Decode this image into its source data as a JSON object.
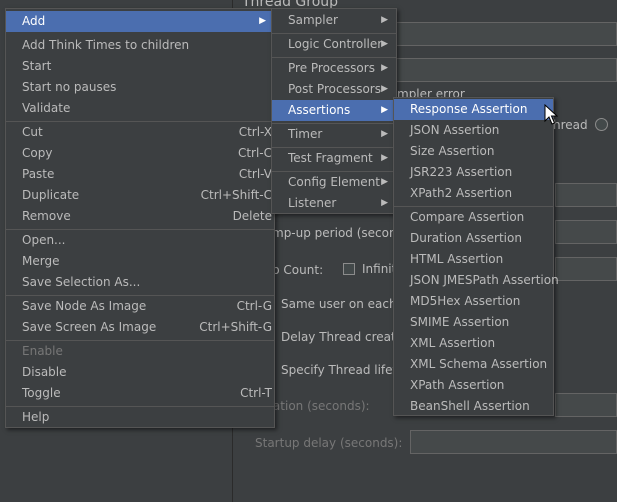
{
  "background": {
    "title_fragment": "Thread Group",
    "sampler_error_fragment": "mpler error",
    "thread_fragment": "hread",
    "ramp_up_fragment": "mp-up period (seconds",
    "loop_count_fragment": "p Count:",
    "infinite_fragment": "Infinit",
    "same_user_fragment": "Same user on each ite",
    "delay_thread_fragment": "Delay Thread creation",
    "specify_lifetime_fragment": "Specify Thread lifetim",
    "duration_fragment": "ration (seconds):",
    "startup_delay_label": "Startup delay (seconds):"
  },
  "context_menu": {
    "add": "Add",
    "add_think_times": "Add Think Times to children",
    "start": "Start",
    "start_no_pauses": "Start no pauses",
    "validate": "Validate",
    "cut": "Cut",
    "cut_sc": "Ctrl-X",
    "copy": "Copy",
    "copy_sc": "Ctrl-C",
    "paste": "Paste",
    "paste_sc": "Ctrl-V",
    "duplicate": "Duplicate",
    "duplicate_sc": "Ctrl+Shift-C",
    "remove": "Remove",
    "remove_sc": "Delete",
    "open": "Open...",
    "merge": "Merge",
    "save_selection": "Save Selection As...",
    "save_node_image": "Save Node As Image",
    "save_node_image_sc": "Ctrl-G",
    "save_screen_image": "Save Screen As Image",
    "save_screen_image_sc": "Ctrl+Shift-G",
    "enable": "Enable",
    "disable": "Disable",
    "toggle": "Toggle",
    "toggle_sc": "Ctrl-T",
    "help": "Help"
  },
  "add_submenu": {
    "sampler": "Sampler",
    "logic_controller": "Logic Controller",
    "pre_processors": "Pre Processors",
    "post_processors": "Post Processors",
    "assertions": "Assertions",
    "timer": "Timer",
    "test_fragment": "Test Fragment",
    "config_element": "Config Element",
    "listener": "Listener"
  },
  "assertions_submenu": {
    "response": "Response Assertion",
    "json": "JSON Assertion",
    "size": "Size Assertion",
    "jsr223": "JSR223 Assertion",
    "xpath2": "XPath2 Assertion",
    "compare": "Compare Assertion",
    "duration": "Duration Assertion",
    "html": "HTML Assertion",
    "json_jmespath": "JSON JMESPath Assertion",
    "md5hex": "MD5Hex Assertion",
    "smime": "SMIME Assertion",
    "xml": "XML Assertion",
    "xml_schema": "XML Schema Assertion",
    "xpath": "XPath Assertion",
    "beanshell": "BeanShell Assertion"
  },
  "colors": {
    "selection": "#4b6eaf",
    "menu_bg": "#3c3f41",
    "text": "#bbbbbb"
  }
}
